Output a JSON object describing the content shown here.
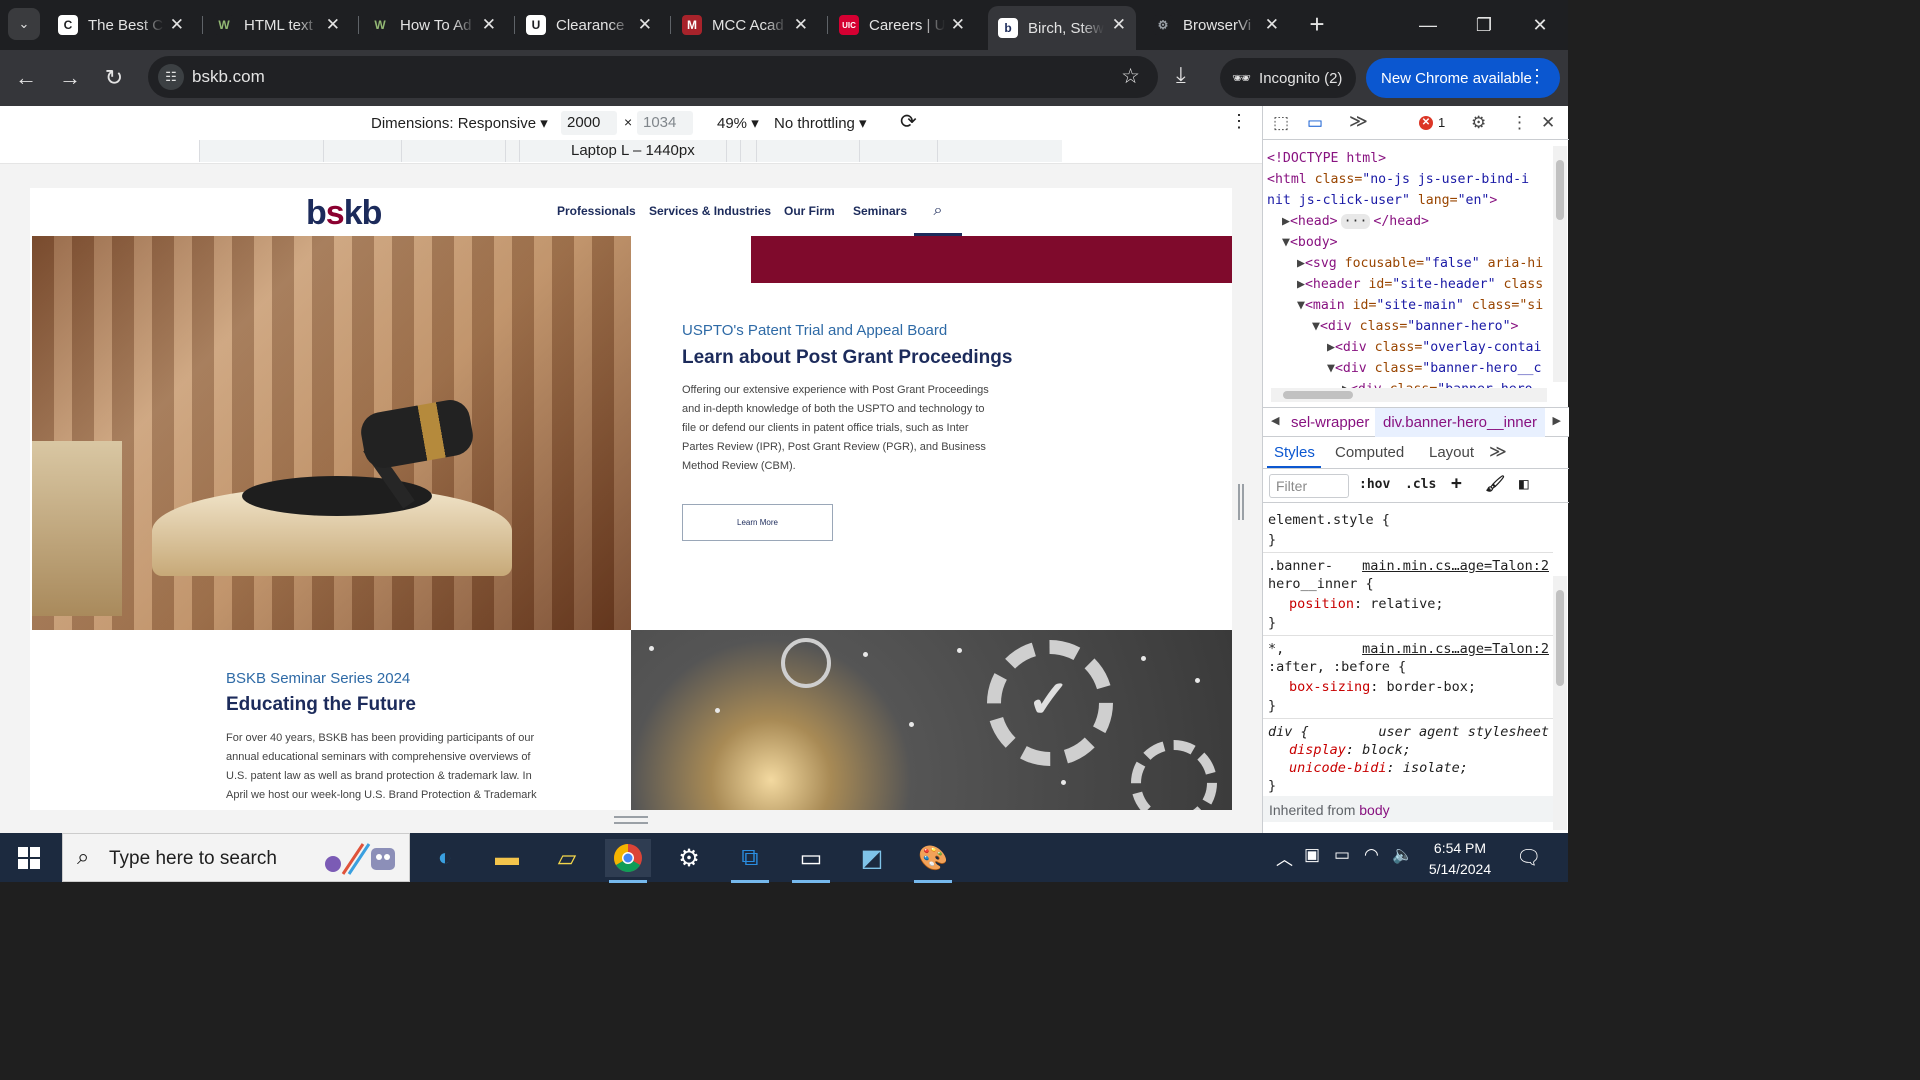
{
  "browser": {
    "tabs": [
      {
        "title": "The Best C",
        "icon": "generic-c-icon",
        "fav_bg": "#ffffff",
        "fav_fg": "#1e1f22",
        "fav_glyph": "C"
      },
      {
        "title": "HTML text",
        "icon": "wikihow-icon",
        "fav_bg": "#1e1f22",
        "fav_fg": "#93b874",
        "fav_glyph": "W"
      },
      {
        "title": "How To Ad",
        "icon": "wikihow-icon",
        "fav_bg": "#1e1f22",
        "fav_fg": "#93b874",
        "fav_glyph": "W"
      },
      {
        "title": "Clearance",
        "icon": "unique-hubs-icon",
        "fav_bg": "#ffffff",
        "fav_fg": "#1e1f22",
        "fav_glyph": "U"
      },
      {
        "title": "MCC Acad",
        "icon": "mcc-shield-icon",
        "fav_bg": "#a8232b",
        "fav_fg": "#ffffff",
        "fav_glyph": "M"
      },
      {
        "title": "Careers | U",
        "icon": "uic-icon",
        "fav_bg": "#d50032",
        "fav_fg": "#ffffff",
        "fav_glyph": "UIC"
      },
      {
        "title": "Birch, Stew",
        "icon": "bskb-icon",
        "fav_bg": "#ffffff",
        "fav_fg": "#1c2b5b",
        "fav_glyph": "b",
        "active": true
      },
      {
        "title": "BrowserVi",
        "icon": "gear-favicon-icon",
        "fav_bg": "#1e1f22",
        "fav_fg": "#9aa0a6",
        "fav_glyph": "⚙"
      }
    ],
    "url": "bskb.com",
    "incognito_label": "Incognito (2)",
    "update_label": "New Chrome available"
  },
  "device_toolbar": {
    "dimensions_label": "Dimensions: Responsive",
    "width": "2000",
    "times": "×",
    "height": "1034",
    "zoom": "49%",
    "throttling": "No throttling",
    "breakpoint_label": "Laptop L – 1440px"
  },
  "site": {
    "logo_b": "b",
    "logo_s": "s",
    "logo_kb": "kb",
    "nav": [
      "Professionals",
      "Services & Industries",
      "Our Firm",
      "Seminars"
    ],
    "hero": {
      "eyebrow": "USPTO's Patent Trial and Appeal Board",
      "headline": "Learn about Post Grant Proceedings",
      "body": [
        "Offering our extensive experience with Post Grant Proceedings",
        "and in-depth knowledge of both the USPTO and technology to",
        "file or defend our clients in patent office trials, such as Inter",
        "Partes Review (IPR), Post Grant Review (PGR), and Business",
        "Method Review (CBM)."
      ],
      "button": "Learn More"
    },
    "seminar": {
      "eyebrow": "BSKB Seminar Series 2024",
      "headline": "Educating the Future",
      "body": [
        "For over 40 years, BSKB has been providing participants of our",
        "annual educational seminars with comprehensive overviews of",
        "U.S. patent law as well as brand protection & trademark law. In",
        "April we host our week-long U.S. Brand Protection & Trademark"
      ]
    },
    "colors": {
      "navy": "#1c2b5b",
      "maroon": "#7f0a2c",
      "link_blue": "#2e6aa6"
    }
  },
  "devtools": {
    "error_count": "1",
    "elements": [
      {
        "indent": 0,
        "tri": "",
        "html": "<!DOCTYPE html>"
      },
      {
        "indent": 0,
        "tri": "",
        "tag": "<html",
        "attr": " class=",
        "val": "\"no-js js-user-bind-i"
      },
      {
        "indent": 0,
        "tri": "",
        "tag": "",
        "attr": "",
        "val": "nit js-click-user\"",
        "tail_attr": " lang=",
        "tail_val": "\"en\"",
        "close": ">"
      },
      {
        "indent": 1,
        "tri": "▶",
        "tag": "<head>",
        "extra": "···",
        "close": "</head>"
      },
      {
        "indent": 1,
        "tri": "▼",
        "tag": "<body>"
      },
      {
        "indent": 2,
        "tri": "▶",
        "tag": "<svg",
        "attr": " focusable=",
        "val": "\"false\"",
        "tail_attr": " aria-hi"
      },
      {
        "indent": 2,
        "tri": "▶",
        "tag": "<header",
        "attr": " id=",
        "val": "\"site-header\"",
        "tail_attr": " class"
      },
      {
        "indent": 2,
        "tri": "▼",
        "tag": "<main",
        "attr": " id=",
        "val": "\"site-main\"",
        "tail_attr": " class=\"si"
      },
      {
        "indent": 3,
        "tri": "▼",
        "tag": "<div",
        "attr": " class=",
        "val": "\"banner-hero\"",
        "close": ">"
      },
      {
        "indent": 4,
        "tri": "▶",
        "tag": "<div",
        "attr": " class=",
        "val": "\"overlay-contai"
      },
      {
        "indent": 4,
        "tri": "▼",
        "tag": "<div",
        "attr": " class=",
        "val": "\"banner-hero__c"
      },
      {
        "indent": 5,
        "tri": "▶",
        "tag": "<div",
        "attr": " class=",
        "val": "\"banner-hero"
      }
    ],
    "breadcrumb_prev": "sel-wrapper",
    "breadcrumb_current": "div.banner-hero__inner",
    "panel_tabs": [
      "Styles",
      "Computed",
      "Layout"
    ],
    "filter_placeholder": "Filter",
    "hov": ":hov",
    "cls": ".cls",
    "rules": [
      {
        "selector": "element.style {",
        "source": "",
        "props": [],
        "close": "}"
      },
      {
        "selector": ".banner-",
        "selector2": "hero__inner {",
        "source": "main.min.cs…age=Talon:2",
        "props": [
          {
            "name": "position",
            "value": "relative;"
          }
        ],
        "close": "}"
      },
      {
        "selector": "*,",
        "selector2": ":after, :before {",
        "source": "main.min.cs…age=Talon:2",
        "props": [
          {
            "name": "box-sizing",
            "value": "border-box;"
          }
        ],
        "close": "}"
      },
      {
        "selector": "div {",
        "source": "user agent stylesheet",
        "props": [
          {
            "name": "display",
            "value": "block;"
          },
          {
            "name": "unicode-bidi",
            "value": "isolate;"
          }
        ],
        "close": "}"
      }
    ],
    "inherited_from": "Inherited from",
    "inherited_el": "body"
  },
  "taskbar": {
    "search_placeholder": "Type here to search",
    "time": "6:54 PM",
    "date": "5/14/2024",
    "apps": [
      "edge-icon",
      "file-explorer-icon",
      "sticky-notes-icon",
      "chrome-icon",
      "settings-icon",
      "vscode-icon",
      "terminal-icon",
      "notepad-icon",
      "paint-icon"
    ]
  }
}
